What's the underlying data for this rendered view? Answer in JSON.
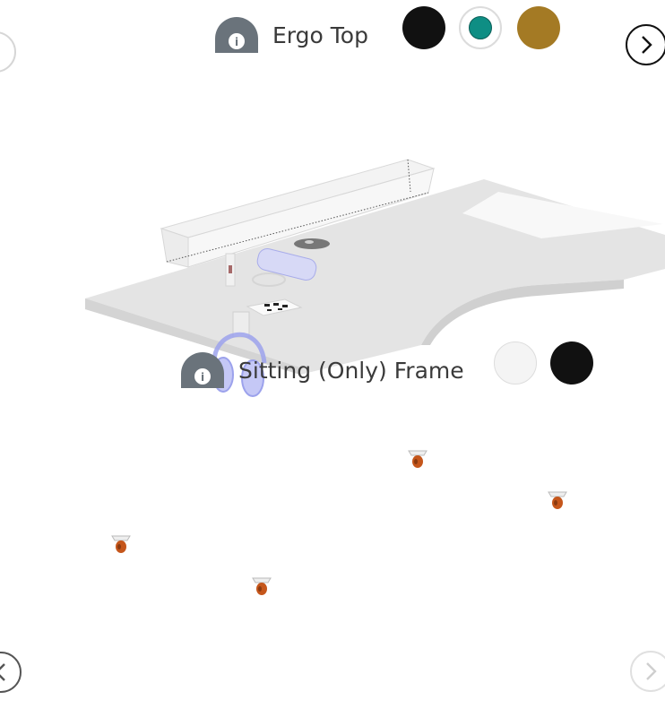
{
  "top_selector": {
    "label": "Ergo Top",
    "info_icon": "info-icon",
    "colors": [
      {
        "name": "black",
        "hex": "#111111",
        "selected": false
      },
      {
        "name": "teal",
        "hex": "#0e8e84",
        "selected": true
      },
      {
        "name": "gold",
        "hex": "#a47a24",
        "selected": false
      }
    ]
  },
  "frame_selector": {
    "label": "Sitting (Only) Frame",
    "info_icon": "info-icon",
    "colors": [
      {
        "name": "white",
        "hex": "#f4f4f4",
        "selected": false
      },
      {
        "name": "black",
        "hex": "#111111",
        "selected": false
      }
    ]
  },
  "navigation": {
    "next_top_icon": "chevron-right-icon",
    "prev_bottom_icon": "chevron-left-icon",
    "next_bottom_icon": "chevron-right-icon",
    "prev_top_icon": "circle-icon"
  },
  "product_preview": {
    "accessories": [
      "cable-tray",
      "wireless-charger",
      "usb-hub",
      "headphone-hook",
      "caster-wheels"
    ]
  }
}
